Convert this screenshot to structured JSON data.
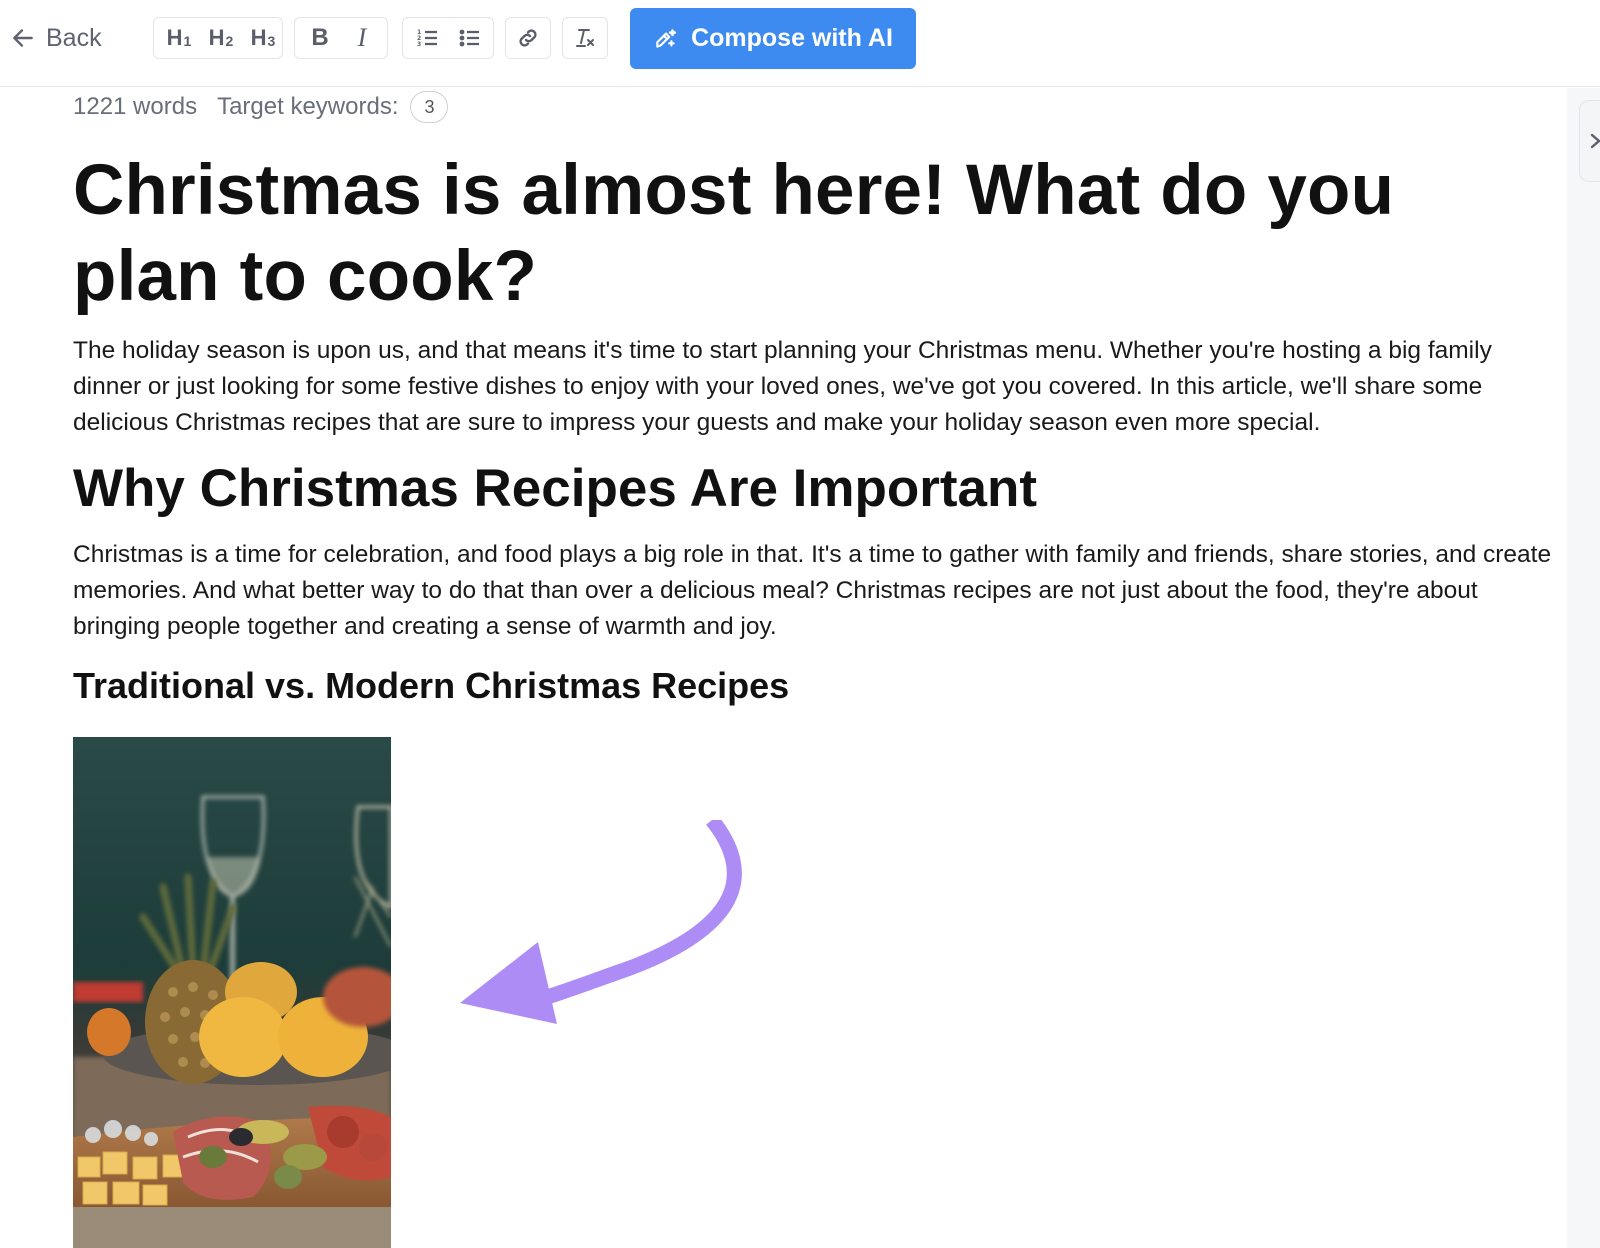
{
  "toolbar": {
    "back_label": "Back",
    "heading_buttons": [
      {
        "label": "H",
        "level": "1"
      },
      {
        "label": "H",
        "level": "2"
      },
      {
        "label": "H",
        "level": "3"
      }
    ],
    "bold_label": "B",
    "italic_label": "I",
    "icons": {
      "back": "arrow-left-icon",
      "ordered_list": "ordered-list-icon",
      "bullet_list": "bullet-list-icon",
      "link": "link-icon",
      "clear_format": "clear-formatting-icon",
      "compose": "magic-wand-icon",
      "sidebar_toggle": "chevron-right-icon"
    },
    "compose_label": "Compose with AI",
    "compose_color": "#3d8bf0"
  },
  "meta": {
    "word_count": "1221 words",
    "keywords_label": "Target keywords:",
    "keywords_count": "3"
  },
  "article": {
    "title": "Christmas is almost here! What do you plan to cook?",
    "intro": "The holiday season is upon us, and that means it's time to start planning your Christmas menu. Whether you're hosting a big family dinner or just looking for some festive dishes to enjoy with your loved ones, we've got you covered. In this article, we'll share some delicious Christmas recipes that are sure to impress your guests and make your holiday season even more special.",
    "h2": "Why Christmas Recipes Are Important",
    "p2": "Christmas is a time for celebration, and food plays a big role in that. It's a time to gather with family and friends, share stories, and create memories. And what better way to do that than over a delicious meal? Christmas recipes are not just about the food, they're about bringing people together and creating a sense of warmth and joy.",
    "h3": "Traditional vs. Modern Christmas Recipes",
    "image_alt": "Festive table with pineapple, lemons, charcuterie board and wine glasses"
  },
  "annotation": {
    "arrow_color": "#ad8cf5"
  }
}
